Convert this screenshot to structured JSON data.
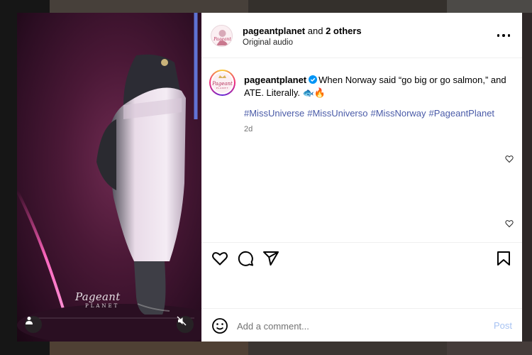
{
  "header": {
    "username": "pageantplanet",
    "and_text": "and",
    "others": "2 others",
    "audio": "Original audio"
  },
  "caption": {
    "username": "pageantplanet",
    "text": "When Norway said “go big or go salmon,” and ATE. Literally. 🐟🔥",
    "hashtags": [
      "#MissUniverse",
      "#MissUniverso",
      "#MissNorway",
      "#PageantPlanet"
    ],
    "time": "2d"
  },
  "media": {
    "watermark": "Pageant",
    "watermark_sub": "PLANET"
  },
  "comment": {
    "placeholder": "Add a comment...",
    "post_label": "Post"
  },
  "icons": {
    "more": "more-options-icon",
    "like": "heart-icon",
    "comment": "comment-icon",
    "share": "share-icon",
    "save": "bookmark-icon",
    "emoji": "emoji-icon",
    "verified": "verified-badge-icon",
    "mute": "muted-audio-icon",
    "tag": "user-tag-icon"
  },
  "colors": {
    "hashtag": "#4a5ba8",
    "verified": "#0095f6",
    "post_disabled": "#a7c3f3"
  }
}
